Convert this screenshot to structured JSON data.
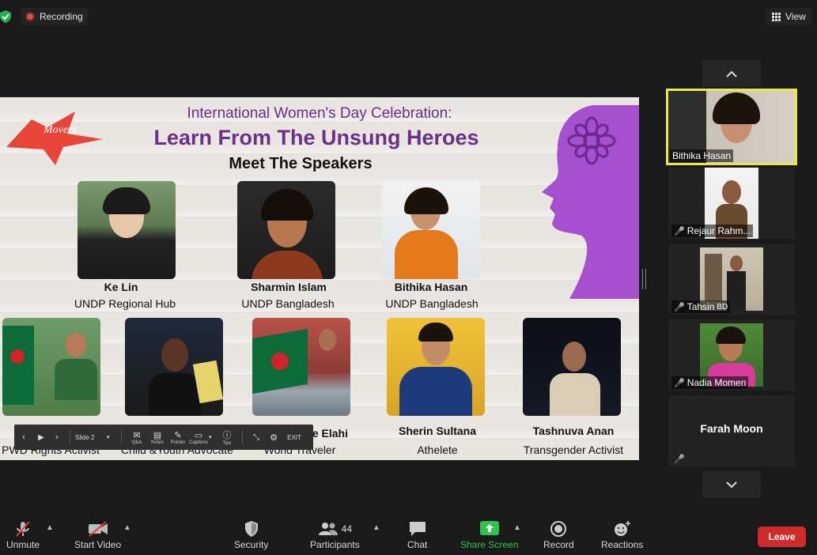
{
  "topbar": {
    "recording_label": "Recording",
    "view_label": "View"
  },
  "slide": {
    "logo_text": "Movers",
    "title": "International Women's Day Celebration:",
    "headline": "Learn From The Unsung Heroes",
    "subtitle": "Meet The Speakers",
    "speakers_top": [
      {
        "name": "Ke Lin",
        "role": "UNDP Regional Hub"
      },
      {
        "name": "Sharmin Islam",
        "role": "UNDP  Bangladesh"
      },
      {
        "name": "Bithika Hasan",
        "role": "UNDP  Bangladesh"
      }
    ],
    "speakers_bottom": [
      {
        "name": "",
        "role": "PWD Rights Activist"
      },
      {
        "name": "",
        "role": "Child &Youth Advocate"
      },
      {
        "name": "e Elahi",
        "role": "World Traveler"
      },
      {
        "name": "Sherin Sultana",
        "role": "Athelete"
      },
      {
        "name": "Tashnuva Anan",
        "role": "Transgender Activist"
      }
    ]
  },
  "slide_toolbar": {
    "slide_label": "Slide 2",
    "buttons": [
      "Q&A",
      "Notes",
      "Pointer",
      "Captions",
      "Tips"
    ],
    "exit_label": "EXIT"
  },
  "participants_panel": {
    "tiles": [
      {
        "name": "Bithika Hasan",
        "muted": false,
        "active": true
      },
      {
        "name": "Rejaur Rahm...",
        "muted": true
      },
      {
        "name": "Tahsin",
        "suffix": "BD",
        "muted": true
      },
      {
        "name": "Nadia Momen",
        "muted": true
      },
      {
        "name": "Farah Moon",
        "muted": true,
        "video_off": true
      }
    ]
  },
  "bottom_bar": {
    "unmute": "Unmute",
    "start_video": "Start Video",
    "security": "Security",
    "participants": "Participants",
    "participants_count": "44",
    "chat": "Chat",
    "share_screen": "Share Screen",
    "record": "Record",
    "reactions": "Reactions",
    "leave": "Leave"
  },
  "colors": {
    "share_green": "#2ec44f",
    "leave_red": "#d02b2b",
    "active_border": "#e8e84a",
    "title_purple": "#6a2f8a"
  }
}
